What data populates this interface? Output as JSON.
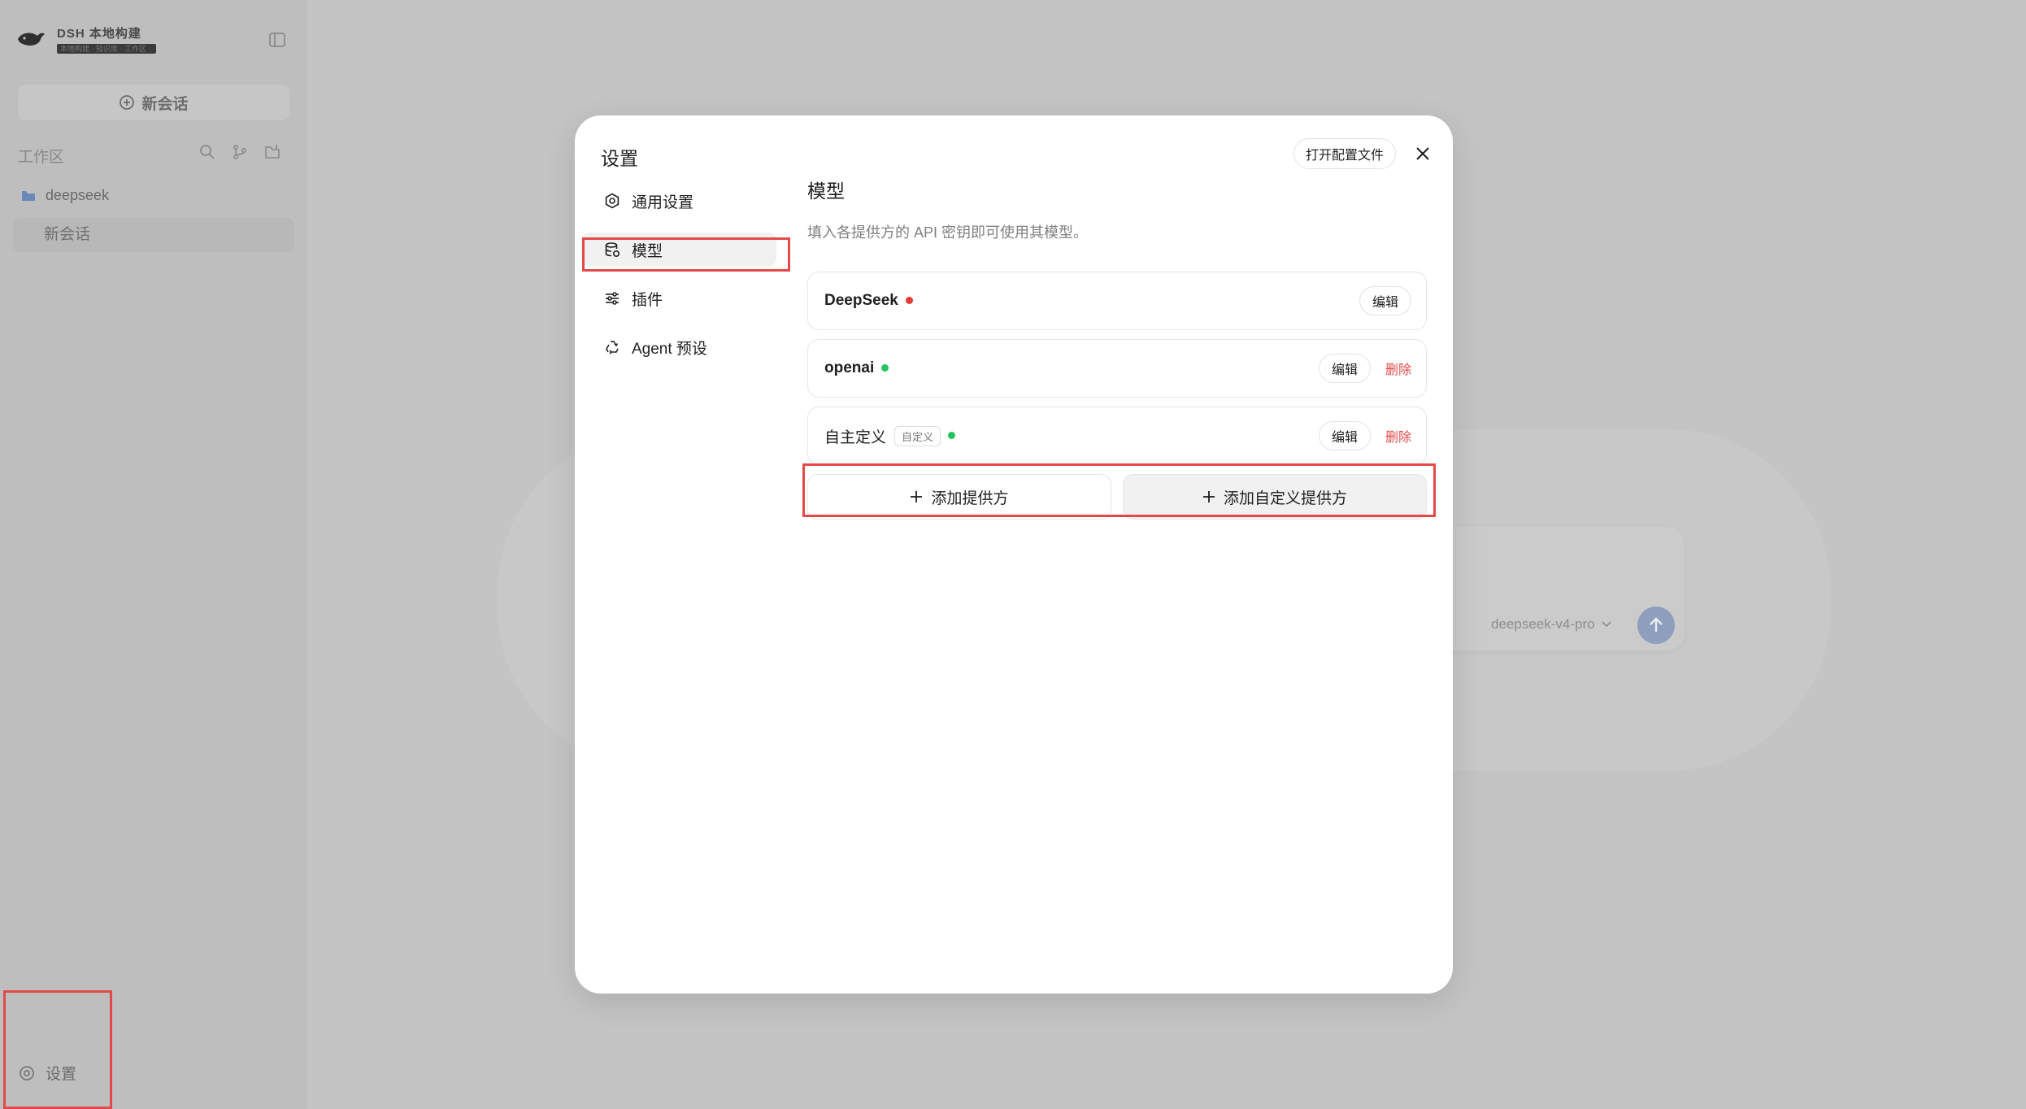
{
  "sidebar": {
    "brand_name": "DSH 本地构建",
    "brand_sub": "本地构建 · 知识库 · 工作区",
    "new_chat_label": "新会话",
    "workspace_label": "工作区",
    "folder_label": "deepseek",
    "session_label": "新会话",
    "settings_label": "设置"
  },
  "composer": {
    "model_label": "deepseek-v4-pro"
  },
  "modal": {
    "title": "设置",
    "open_config_label": "打开配置文件",
    "nav": [
      {
        "label": "通用设置",
        "icon": "gear-icon"
      },
      {
        "label": "模型",
        "icon": "database-icon",
        "active": true
      },
      {
        "label": "插件",
        "icon": "sliders-icon"
      },
      {
        "label": "Agent 预设",
        "icon": "recycle-icon"
      }
    ],
    "section_title": "模型",
    "section_desc": "填入各提供方的 API 密钥即可使用其模型。",
    "providers": [
      {
        "name": "DeepSeek",
        "status_color": "#e53935",
        "edit_label": "编辑"
      },
      {
        "name": "openai",
        "status_color": "#22c55e",
        "edit_label": "编辑",
        "delete_label": "删除"
      },
      {
        "name": "自主定义",
        "tag": "自定义",
        "status_color": "#22c55e",
        "edit_label": "编辑",
        "delete_label": "删除"
      }
    ],
    "add_provider_label": "添加提供方",
    "add_custom_provider_label": "添加自定义提供方"
  },
  "colors": {
    "accent_red": "#e24a4a",
    "status_green": "#22c55e",
    "status_red": "#e53935"
  }
}
